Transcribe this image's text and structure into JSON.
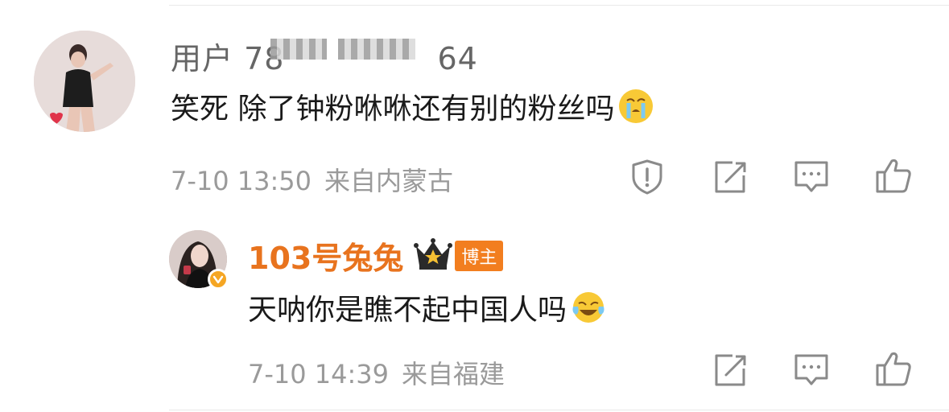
{
  "comment": {
    "username": "用户 78",
    "username_tail": "64",
    "text": "笑死 除了钟粉咻咻还有别的粉丝吗",
    "emoji": "crying-face-emoji",
    "time": "7-10 13:50",
    "location": "来自内蒙古",
    "actions": [
      "report-icon",
      "repost-icon",
      "comment-icon",
      "like-icon"
    ]
  },
  "reply": {
    "username": "103号兔兔",
    "badge": "博主",
    "crown": "crown-icon",
    "text": "天呐你是瞧不起中国人吗",
    "emoji": "laughing-crying-emoji",
    "time": "7-10 14:39",
    "location": "来自福建",
    "actions": [
      "repost-icon",
      "comment-icon",
      "like-icon"
    ]
  },
  "colors": {
    "username_gray": "#666666",
    "text_black": "#1a1a1a",
    "meta_gray": "#9a9a9a",
    "author_orange": "#e8731e",
    "badge_orange": "#f27e1f",
    "verified_orange": "#f5a623"
  }
}
